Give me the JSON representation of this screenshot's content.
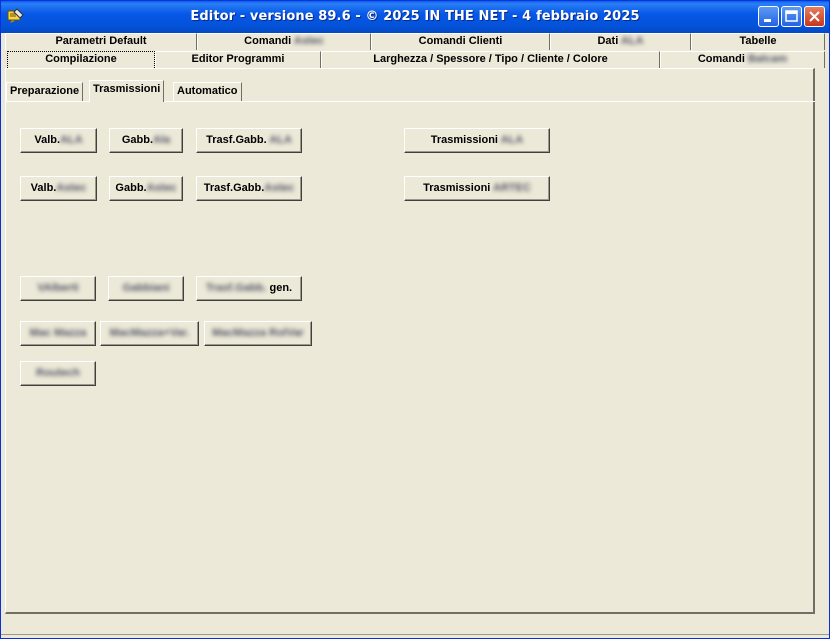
{
  "window": {
    "title": "Editor - versione 89.6 - © 2025  IN THE NET - 4 febbraio 2025",
    "controls": {
      "minimize": "minimize-icon",
      "maximize": "maximize-icon",
      "close": "close-icon"
    }
  },
  "tabs_row1": [
    {
      "label": "Parametri Default",
      "blur": ""
    },
    {
      "label": "Comandi ",
      "blur": "Astec"
    },
    {
      "label": "Comandi Clienti",
      "blur": ""
    },
    {
      "label": "Dati ",
      "blur": "ALA"
    },
    {
      "label": "Tabelle",
      "blur": ""
    }
  ],
  "tabs_row2": [
    {
      "label": "Compilazione",
      "blur": ""
    },
    {
      "label": "Editor Programmi",
      "blur": ""
    },
    {
      "label": "Larghezza / Spessore / Tipo / Cliente / Colore",
      "blur": ""
    },
    {
      "label": "Comandi ",
      "blur": "Balcam"
    }
  ],
  "subtabs": [
    {
      "label": "Preparazione"
    },
    {
      "label": "Trasmissioni"
    },
    {
      "label": "Automatico"
    }
  ],
  "buttons": {
    "valb_ala": {
      "label": "Valb.",
      "blur": "ALA"
    },
    "gabb_ala": {
      "label": "Gabb.",
      "blur": "Ala"
    },
    "trasf_gabb_ala": {
      "label": "Trasf.Gabb. ",
      "blur": "ALA"
    },
    "trasmissioni_ala": {
      "label": "Trasmissioni ",
      "blur": "ALA"
    },
    "valb_astec": {
      "label": "Valb.",
      "blur": "Astec"
    },
    "gabb_astec": {
      "label": "Gabb.",
      "blur": "Astec"
    },
    "trasf_gabb_astec": {
      "label": "Trasf.Gabb.",
      "blur": "Astec"
    },
    "trasmissioni_artec": {
      "label": "Trasmissioni ",
      "blur": "ARTEC"
    },
    "valberti": {
      "label": "",
      "blur": "VAlberti"
    },
    "gabbiani": {
      "label": "",
      "blur": "Gabbiani"
    },
    "trasf_gabb_gen": {
      "label": " gen.",
      "blur": "Trasf.Gabb."
    },
    "mac_mazza": {
      "label": "",
      "blur": "Mac Mazza"
    },
    "macmazza_var": {
      "label": "",
      "blur": "MacMazza+Var."
    },
    "macmazza_rolvar": {
      "label": "",
      "blur": "MacMazza RolVar"
    },
    "routech": {
      "label": "",
      "blur": "Routech"
    }
  }
}
